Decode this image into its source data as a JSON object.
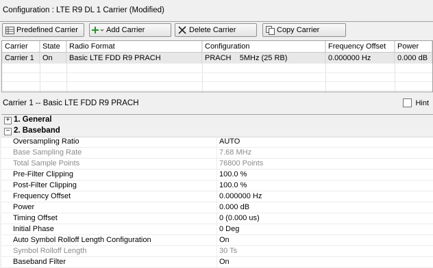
{
  "title": "Configuration : LTE R9 DL 1 Carrier (Modified)",
  "toolbar": {
    "predefined": "Predefined Carrier",
    "add": "Add Carrier",
    "delete": "Delete Carrier",
    "copy": "Copy Carrier"
  },
  "grid": {
    "columns": [
      "Carrier",
      "State",
      "Radio Format",
      "Configuration",
      "Frequency Offset",
      "Power"
    ],
    "rows": [
      [
        "Carrier 1",
        "On",
        "Basic LTE FDD R9 PRACH",
        "PRACH    5MHz (25 RB)",
        "0.000000 Hz",
        "0.000 dB"
      ]
    ]
  },
  "carrier_label": "Carrier 1 -- Basic LTE FDD R9 PRACH",
  "hint": "Hint",
  "sections": {
    "general": "1. General",
    "baseband": "2. Baseband"
  },
  "properties": [
    {
      "name": "Oversampling Ratio",
      "value": "AUTO",
      "disabled": false
    },
    {
      "name": "Base Sampling Rate",
      "value": "7.68 MHz",
      "disabled": true
    },
    {
      "name": "Total Sample Points",
      "value": "76800 Points",
      "disabled": true
    },
    {
      "name": "Pre-Filter Clipping",
      "value": "100.0 %",
      "disabled": false
    },
    {
      "name": "Post-Filter Clipping",
      "value": "100.0 %",
      "disabled": false
    },
    {
      "name": "Frequency Offset",
      "value": "0.000000 Hz",
      "disabled": false
    },
    {
      "name": "Power",
      "value": "0.000 dB",
      "disabled": false
    },
    {
      "name": "Timing Offset",
      "value": "0 (0.000 us)",
      "disabled": false
    },
    {
      "name": "Initial Phase",
      "value": "0 Deg",
      "disabled": false
    },
    {
      "name": "Auto Symbol Rolloff Length Configuration",
      "value": "On",
      "disabled": false
    },
    {
      "name": "Symbol Rolloff Length",
      "value": "30 Ts",
      "disabled": true
    },
    {
      "name": "Baseband Filter",
      "value": "On",
      "disabled": false
    }
  ]
}
